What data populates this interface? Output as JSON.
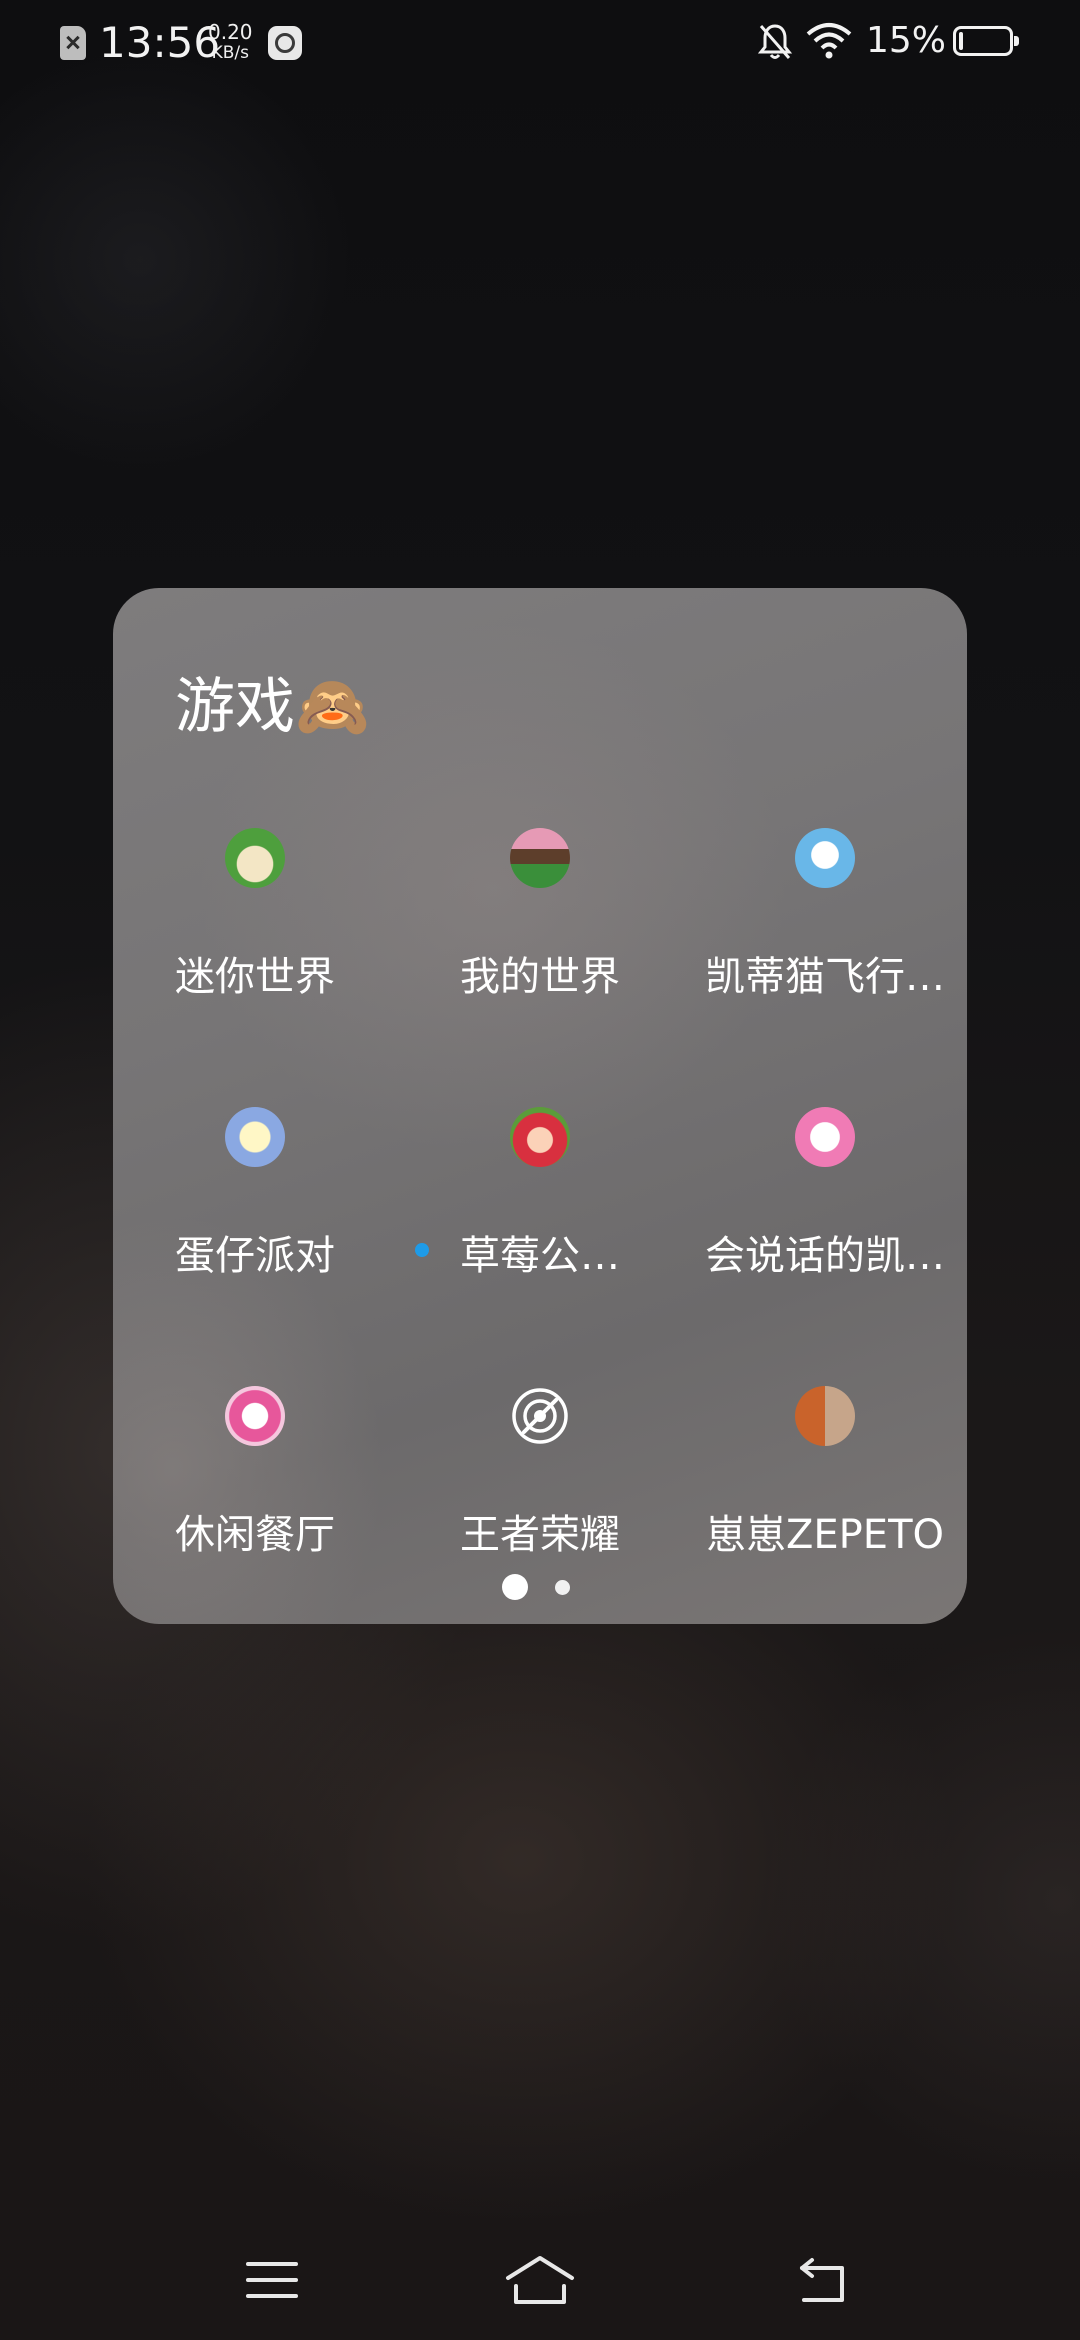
{
  "status_bar": {
    "time": "13:56",
    "net_speed_value": "0.20",
    "net_speed_unit": "KB/s",
    "battery_percent": "15%",
    "icons": [
      "sim-error-icon",
      "app-notification-icon",
      "bell-off-icon",
      "wifi-icon",
      "battery-icon"
    ]
  },
  "folder": {
    "title": "游戏🙈",
    "apps": [
      {
        "label": "迷你世界",
        "icon": "mini-world-icon",
        "new": false
      },
      {
        "label": "我的世界",
        "icon": "minecraft-icon",
        "new": false
      },
      {
        "label": "凯蒂猫飞行…",
        "icon": "hello-kitty-flight-icon",
        "new": false
      },
      {
        "label": "蛋仔派对",
        "icon": "eggy-party-icon",
        "new": false
      },
      {
        "label": "草莓公…",
        "icon": "strawberry-princess-icon",
        "new": true
      },
      {
        "label": "会说话的凯…",
        "icon": "talking-kitty-icon",
        "new": false
      },
      {
        "label": "休闲餐厅",
        "icon": "leisure-restaurant-icon",
        "new": false
      },
      {
        "label": "王者荣耀",
        "icon": "honor-of-kings-icon",
        "new": false
      },
      {
        "label": "崽崽ZEPETO",
        "icon": "zepeto-icon",
        "new": false
      }
    ],
    "pages": {
      "count": 2,
      "current": 1
    }
  },
  "nav_bar": {
    "items": [
      "menu-icon",
      "home-icon",
      "back-icon"
    ]
  },
  "colors": {
    "new_dot": "#1e9be8",
    "folder_bg": "#7a7879"
  }
}
